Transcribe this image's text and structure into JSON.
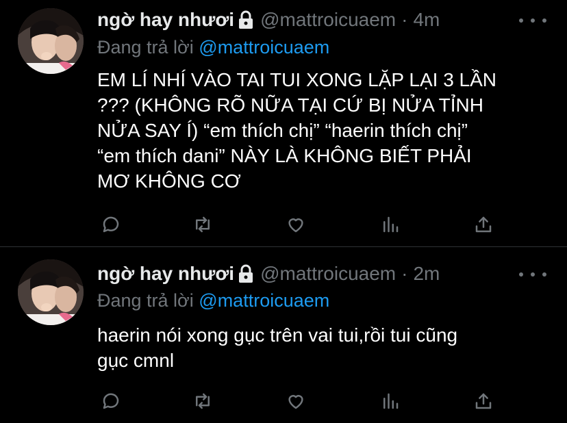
{
  "tweets": [
    {
      "author_name": "ngờ hay nhươi",
      "handle": "@mattroicuaem",
      "separator": "·",
      "time": "4m",
      "reply_prefix": "Đang trả lời",
      "reply_to": "@mattroicuaem",
      "lines": [
        "EM LÍ NHÍ VÀO TAI TUI XONG LẶP LẠI 3 LẦN",
        "??? (KHÔNG RÕ NỮA TẠI CỨ BỊ NỬA TỈNH",
        "NỬA SAY Í) “em thích chị” “haerin thích chị”",
        "“em thích dani” NÀY LÀ KHÔNG BIẾT PHẢI",
        "MƠ KHÔNG CƠ"
      ]
    },
    {
      "author_name": "ngờ hay nhươi",
      "handle": "@mattroicuaem",
      "separator": "·",
      "time": "2m",
      "reply_prefix": "Đang trả lời",
      "reply_to": "@mattroicuaem",
      "lines": [
        "haerin nói xong gục trên vai tui,rồi tui cũng",
        "gục cmnl"
      ]
    }
  ],
  "icons": {
    "lock": "lock-icon",
    "more": "more-icon",
    "reply": "reply-icon",
    "retweet": "retweet-icon",
    "like": "heart-icon",
    "analytics": "analytics-icon",
    "share": "share-icon"
  },
  "colors": {
    "background": "#000000",
    "text": "#ffffff",
    "muted": "#71767b",
    "link": "#1d9bf0",
    "divider": "#2f3336"
  }
}
